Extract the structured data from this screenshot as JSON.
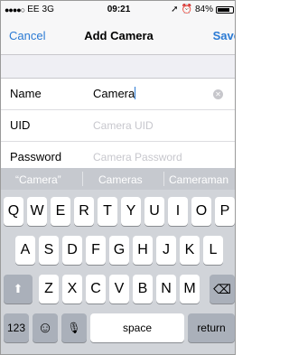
{
  "status_bar": {
    "signal": "●●●●○",
    "carrier": "EE",
    "network": "3G",
    "time": "09:21",
    "location_glyph": "➚",
    "alarm_glyph": "⏰",
    "battery_percent": "84%",
    "battery_level": 0.84
  },
  "nav": {
    "cancel_label": "Cancel",
    "title": "Add Camera",
    "save_label": "Save"
  },
  "form": {
    "name": {
      "label": "Name",
      "value": "Camera"
    },
    "uid": {
      "label": "UID",
      "placeholder": "Camera UID"
    },
    "password": {
      "label": "Password",
      "placeholder": "Camera Password"
    }
  },
  "keyboard": {
    "suggestions": [
      "“Camera”",
      "Cameras",
      "Cameraman"
    ],
    "row1": [
      "Q",
      "W",
      "E",
      "R",
      "T",
      "Y",
      "U",
      "I",
      "O",
      "P"
    ],
    "row2": [
      "A",
      "S",
      "D",
      "F",
      "G",
      "H",
      "J",
      "K",
      "L"
    ],
    "row3": [
      "Z",
      "X",
      "C",
      "V",
      "B",
      "N",
      "M"
    ],
    "shift_glyph": "⬆",
    "delete_glyph": "⌫",
    "numbers_label": "123",
    "emoji_glyph": "☺",
    "mic_glyph": "🎙",
    "space_label": "space",
    "return_label": "return"
  },
  "colors": {
    "accent": "#2a7ad4",
    "keyboard_bg": "#d1d4d9",
    "function_key": "#aab0ba"
  }
}
